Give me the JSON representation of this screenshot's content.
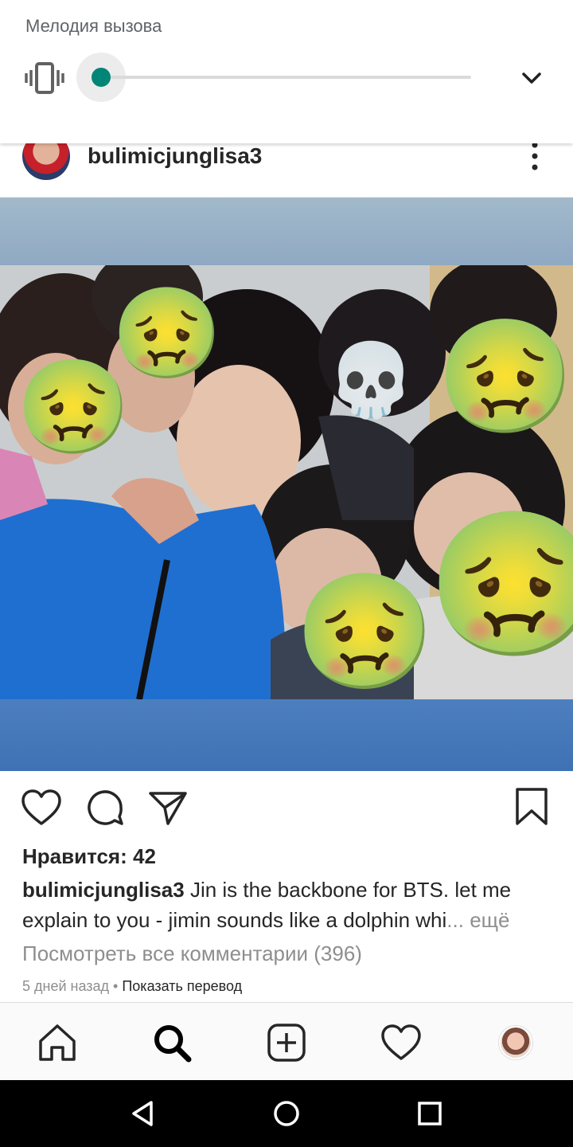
{
  "volume_panel": {
    "title": "Мелодия вызова",
    "level_fraction": 0.0,
    "accent_color": "#008577",
    "icons": {
      "mode": "vibrate-icon",
      "expand": "chevron-down-icon"
    }
  },
  "post": {
    "username": "bulimicjunglisa3",
    "likes_text": "Нравится: 42",
    "caption_user": "bulimicjunglisa3",
    "caption_text": " Jin is the backbone for BTS. let me explain to you - jimin sounds like a dolphin whi",
    "caption_more": "... ещё",
    "view_comments": "Посмотреть все комментарии (396)",
    "timestamp": "5 дней назад",
    "meta_separator": " • ",
    "translate_link": "Показать перевод",
    "photo_emojis": [
      "🤢",
      "🤢",
      "💀",
      "🤢",
      "🤢",
      "🤢"
    ],
    "icons": {
      "more": "more-vertical-icon",
      "like": "heart-icon",
      "comment": "comment-icon",
      "share": "send-icon",
      "save": "bookmark-icon"
    }
  },
  "bottom_nav": {
    "items": [
      "home-icon",
      "search-icon",
      "add-post-icon",
      "activity-heart-icon",
      "profile-avatar"
    ]
  },
  "system_nav": {
    "items": [
      "back-icon",
      "home-circle-icon",
      "recents-icon"
    ]
  }
}
